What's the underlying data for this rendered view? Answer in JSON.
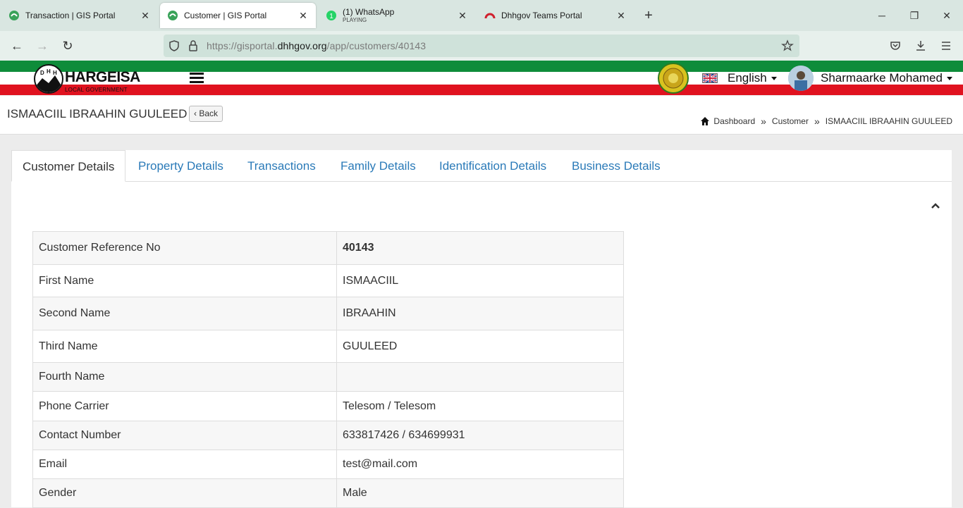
{
  "browser": {
    "tabs": [
      {
        "title": "Transaction | GIS Portal",
        "subtitle": ""
      },
      {
        "title": "Customer | GIS Portal",
        "subtitle": ""
      },
      {
        "title": "(1) WhatsApp",
        "subtitle": "PLAYING"
      },
      {
        "title": "Dhhgov Teams Portal",
        "subtitle": ""
      }
    ],
    "url_prefix": "https://gisportal.",
    "url_host": "dhhgov.org",
    "url_path": "/app/customers/40143"
  },
  "header": {
    "logo_main": "HARGEISA",
    "logo_sub": "LOCAL GOVERNMENT",
    "logo_letters": [
      "D",
      "H",
      "H"
    ],
    "language": "English",
    "user_name": "Sharmaarke Mohamed"
  },
  "page": {
    "title": "ISMAACIIL IBRAAHIN GUULEED",
    "back_label": "Back",
    "breadcrumb": [
      "Dashboard",
      "Customer",
      "ISMAACIIL IBRAAHIN GUULEED"
    ],
    "breadcrumb_separator": "»"
  },
  "tabs": [
    {
      "label": "Customer Details",
      "active": true
    },
    {
      "label": "Property Details",
      "active": false
    },
    {
      "label": "Transactions",
      "active": false
    },
    {
      "label": "Family Details",
      "active": false
    },
    {
      "label": "Identification Details",
      "active": false
    },
    {
      "label": "Business Details",
      "active": false
    }
  ],
  "details": [
    {
      "label": "Customer Reference No",
      "value": "40143"
    },
    {
      "label": "First Name",
      "value": "ISMAACIIL"
    },
    {
      "label": "Second Name",
      "value": "IBRAAHIN"
    },
    {
      "label": "Third Name",
      "value": "GUULEED"
    },
    {
      "label": "Fourth Name",
      "value": ""
    },
    {
      "label": "Phone Carrier",
      "value": "Telesom / Telesom"
    },
    {
      "label": "Contact Number",
      "value": "633817426 / 634699931"
    },
    {
      "label": "Email",
      "value": "test@mail.com"
    },
    {
      "label": "Gender",
      "value": "Male"
    }
  ],
  "colors": {
    "flag_green": "#0e8c3a",
    "flag_red": "#e0121f",
    "link_blue": "#2a7ab8"
  }
}
